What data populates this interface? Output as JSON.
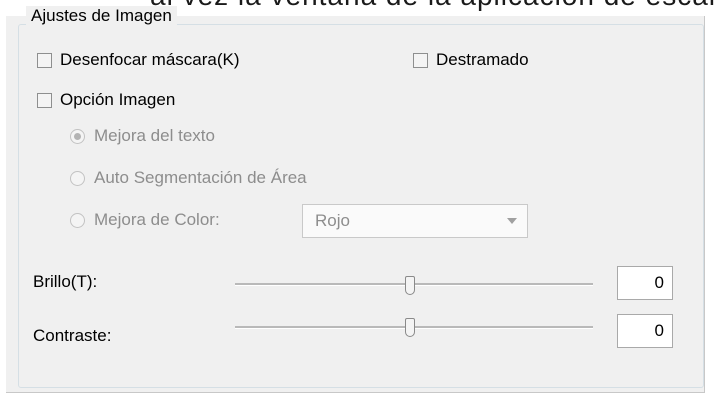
{
  "header_fragment": "al vez la ventana de la aplicación de escaneo",
  "group": {
    "title": "Ajustes de Imagen"
  },
  "checkboxes": {
    "unsharp_mask": {
      "label": "Desenfocar máscara(K)",
      "checked": false
    },
    "descreening": {
      "label": "Destramado",
      "checked": false
    },
    "image_option": {
      "label": "Opción Imagen",
      "checked": false
    }
  },
  "radios": [
    {
      "label": "Mejora del texto",
      "selected": true
    },
    {
      "label": "Auto Segmentación de Área",
      "selected": false
    },
    {
      "label": "Mejora de Color:",
      "selected": false
    }
  ],
  "color_select": {
    "value": "Rojo"
  },
  "brightness": {
    "label": "Brillo(T):",
    "value": "0"
  },
  "contrast": {
    "label": "Contraste:",
    "value": "0"
  },
  "slider_position_fraction": 0.5
}
